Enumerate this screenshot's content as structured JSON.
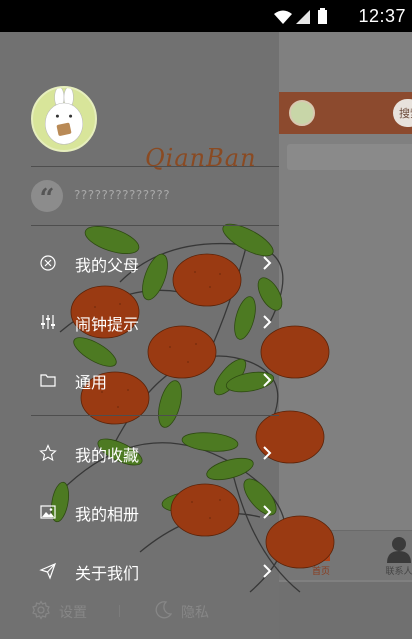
{
  "status_bar": {
    "time": "12:37",
    "icons": [
      "wifi-icon",
      "signal-icon",
      "battery-icon"
    ]
  },
  "drawer": {
    "signature_title": "QianBan",
    "quote_text": "??????????????",
    "menu_groups": [
      [
        {
          "id": "parents",
          "icon": "close-circle-icon",
          "label": "我的父母"
        },
        {
          "id": "alarm",
          "icon": "sliders-icon",
          "label": "闹钟提示"
        },
        {
          "id": "general",
          "icon": "folder-icon",
          "label": "通用"
        }
      ],
      [
        {
          "id": "favorites",
          "icon": "star-icon",
          "label": "我的收藏"
        },
        {
          "id": "album",
          "icon": "image-icon",
          "label": "我的相册"
        },
        {
          "id": "about",
          "icon": "send-icon",
          "label": "关于我们"
        }
      ]
    ],
    "bottom": {
      "settings_label": "设置",
      "privacy_label": "隐私"
    }
  },
  "background_app": {
    "search_text": "搜索",
    "tabs": [
      {
        "id": "home",
        "icon": "home-icon",
        "label": "首页"
      },
      {
        "id": "contacts",
        "icon": "person-icon",
        "label": "联系人"
      }
    ]
  },
  "colors": {
    "accent_orange": "#d4501c",
    "fruit": "#9a3a12",
    "leaf": "#3f6a1c",
    "drawer_overlay": "#717171"
  }
}
